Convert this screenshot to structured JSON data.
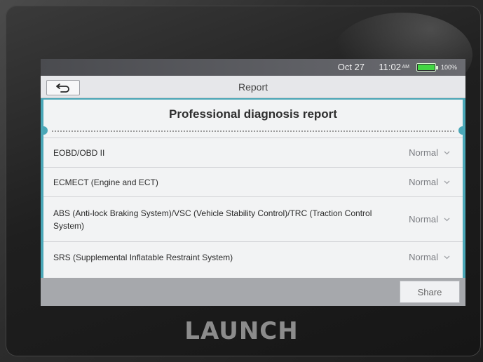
{
  "status_bar": {
    "date": "Oct 27",
    "time": "11:02",
    "ampm": "AM",
    "battery_percent": "100%",
    "battery_level": 1.0
  },
  "header": {
    "title": "Report",
    "back_icon": "back-arrow-icon"
  },
  "report": {
    "title": "Professional diagnosis report",
    "items": [
      {
        "name": "EOBD/OBD II",
        "status": "Normal"
      },
      {
        "name": "ECMECT (Engine and ECT)",
        "status": "Normal"
      },
      {
        "name": "ABS (Anti-lock Braking System)/VSC (Vehicle Stability Control)/TRC (Traction Control System)",
        "status": "Normal"
      },
      {
        "name": "SRS (Supplemental Inflatable Restraint System)",
        "status": "Normal"
      }
    ]
  },
  "footer": {
    "share_label": "Share"
  },
  "device": {
    "brand": "LAUNCH"
  },
  "colors": {
    "accent": "#4aa7b7",
    "battery": "#43d643"
  }
}
